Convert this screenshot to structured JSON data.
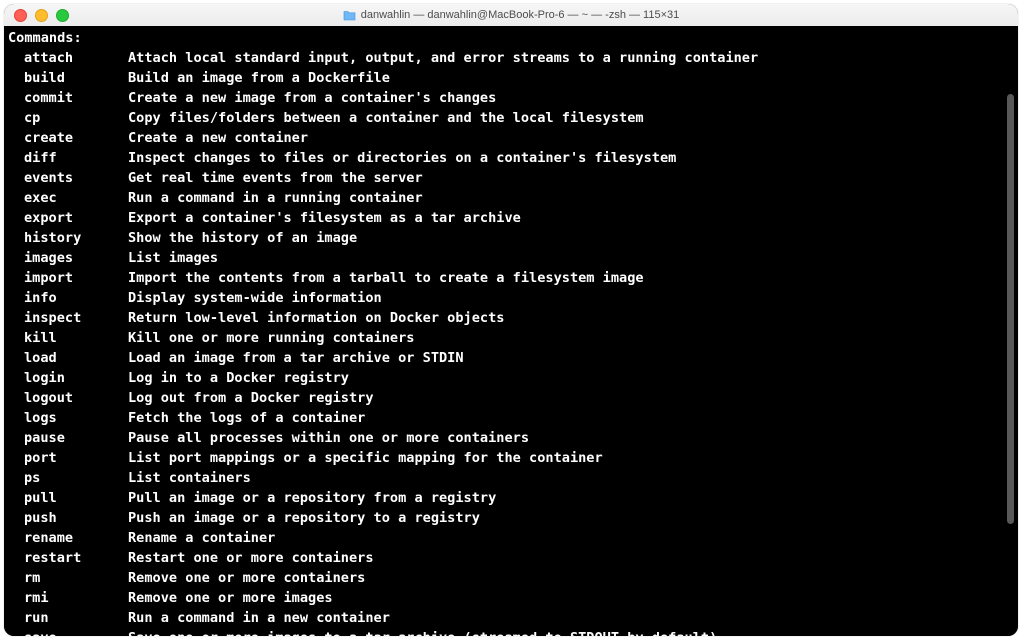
{
  "titlebar": {
    "title": "danwahlin — danwahlin@MacBook-Pro-6 — ~ — -zsh — 115×31"
  },
  "terminal": {
    "heading": "Commands:",
    "commands": [
      {
        "name": "attach",
        "desc": "Attach local standard input, output, and error streams to a running container"
      },
      {
        "name": "build",
        "desc": "Build an image from a Dockerfile"
      },
      {
        "name": "commit",
        "desc": "Create a new image from a container's changes"
      },
      {
        "name": "cp",
        "desc": "Copy files/folders between a container and the local filesystem"
      },
      {
        "name": "create",
        "desc": "Create a new container"
      },
      {
        "name": "diff",
        "desc": "Inspect changes to files or directories on a container's filesystem"
      },
      {
        "name": "events",
        "desc": "Get real time events from the server"
      },
      {
        "name": "exec",
        "desc": "Run a command in a running container"
      },
      {
        "name": "export",
        "desc": "Export a container's filesystem as a tar archive"
      },
      {
        "name": "history",
        "desc": "Show the history of an image"
      },
      {
        "name": "images",
        "desc": "List images"
      },
      {
        "name": "import",
        "desc": "Import the contents from a tarball to create a filesystem image"
      },
      {
        "name": "info",
        "desc": "Display system-wide information"
      },
      {
        "name": "inspect",
        "desc": "Return low-level information on Docker objects"
      },
      {
        "name": "kill",
        "desc": "Kill one or more running containers"
      },
      {
        "name": "load",
        "desc": "Load an image from a tar archive or STDIN"
      },
      {
        "name": "login",
        "desc": "Log in to a Docker registry"
      },
      {
        "name": "logout",
        "desc": "Log out from a Docker registry"
      },
      {
        "name": "logs",
        "desc": "Fetch the logs of a container"
      },
      {
        "name": "pause",
        "desc": "Pause all processes within one or more containers"
      },
      {
        "name": "port",
        "desc": "List port mappings or a specific mapping for the container"
      },
      {
        "name": "ps",
        "desc": "List containers"
      },
      {
        "name": "pull",
        "desc": "Pull an image or a repository from a registry"
      },
      {
        "name": "push",
        "desc": "Push an image or a repository to a registry"
      },
      {
        "name": "rename",
        "desc": "Rename a container"
      },
      {
        "name": "restart",
        "desc": "Restart one or more containers"
      },
      {
        "name": "rm",
        "desc": "Remove one or more containers"
      },
      {
        "name": "rmi",
        "desc": "Remove one or more images"
      },
      {
        "name": "run",
        "desc": "Run a command in a new container"
      },
      {
        "name": "save",
        "desc": "Save one or more images to a tar archive (streamed to STDOUT by default)"
      }
    ]
  }
}
